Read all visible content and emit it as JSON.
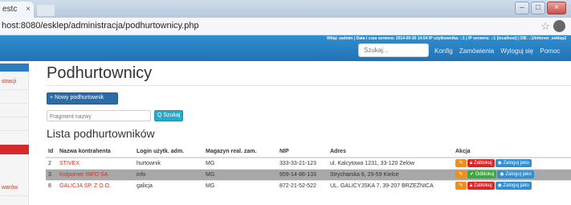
{
  "browser": {
    "tab_title": "estc",
    "tab_close": "×",
    "url_host": "host:8080",
    "url_path": "/esklep/administracja/podhurtownicy.php",
    "star": "☆"
  },
  "navbar": {
    "infobar": "Witaj: sadmin | Data i czas serwera: 2014-09-30 14:54 IP użytkownika: ::1 | IP serwera: ::1 (localhost) | DB: ::1/inhover_esklep2",
    "search_placeholder": "Szukaj...",
    "links": [
      "Konfig",
      "Zamówienia",
      "Wyloguj się",
      "Pomoc"
    ]
  },
  "sidebar": {
    "items": [
      "stracji",
      "warów"
    ]
  },
  "main": {
    "title": "Podhurtownicy",
    "new_button": "+ Nowy podhurtownik",
    "filter_placeholder": "Fragment nazwy",
    "search_button": "Q Szukaj",
    "list_title": "Lista podhurtowników"
  },
  "table": {
    "headers": [
      "Id",
      "Nazwa kontrahenta",
      "Login użytk. adm.",
      "Magazyn real. zam.",
      "NIP",
      "Adres",
      "Akcja"
    ],
    "rows": [
      {
        "id": "2",
        "name": "STIVEX",
        "login": "hurtownik",
        "mag": "MG",
        "nip": "333-33-21-123",
        "addr": "ul. Kalcytowa 1231, 33-120 Zelów",
        "blocked": false
      },
      {
        "id": "3",
        "name": "Kolporner INFO SA",
        "login": "info",
        "mag": "MG",
        "nip": "959-14-86-133",
        "addr": "Strycharska 6, 25-59 Kielce",
        "blocked": true
      },
      {
        "id": "8",
        "name": "GALICJA SP. Z O.O.",
        "login": "galicja",
        "mag": "MG",
        "nip": "872-21-52-522",
        "addr": "UL. GALICYJSKA 7, 39-207 BRZEŹNICA",
        "blocked": false
      }
    ],
    "actions": {
      "edit": "✎",
      "block": "Zablokuj",
      "unblock": "Odblokuj",
      "login_as": "Zaloguj jako"
    }
  },
  "colors": {
    "navbar": "#2372b5",
    "danger": "#d9282b",
    "success": "#3fa73f",
    "warning": "#ef8f1d",
    "info": "#2f8fd1"
  }
}
